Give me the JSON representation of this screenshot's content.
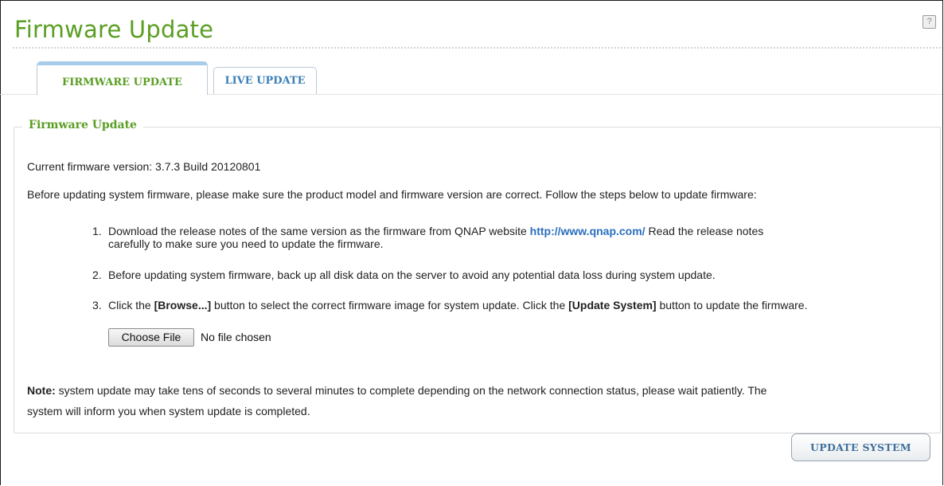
{
  "page": {
    "title": "Firmware Update",
    "help_icon": "?"
  },
  "tabs": [
    {
      "label": "FIRMWARE UPDATE",
      "active": true
    },
    {
      "label": "LIVE UPDATE",
      "active": false
    }
  ],
  "section": {
    "legend": "Firmware Update",
    "current_version": "Current firmware version: 3.7.3 Build 20120801",
    "intro": "Before updating system firmware, please make sure the product model and firmware version are correct. Follow the steps below to update firmware:",
    "steps": [
      {
        "number": "1.",
        "line1_a": "Download the release notes of the same version as the firmware from QNAP website ",
        "link": "http://www.qnap.com/",
        "line1_b": " Read the release notes",
        "line2": "carefully to make sure you need to update the firmware."
      },
      {
        "number": "2.",
        "text": "Before updating system firmware, back up all disk data on the server to avoid any potential data loss during system update."
      },
      {
        "number": "3.",
        "text_a": "Click the ",
        "bold_a": "[Browse...]",
        "text_b": " button to select the correct firmware image for system update. Click the ",
        "bold_b": "[Update System]",
        "text_c": " button to update the firmware."
      }
    ],
    "file_input": {
      "button_label": "Choose File",
      "status": "No file chosen"
    },
    "note": {
      "label": "Note:",
      "line1": " system update may take tens of seconds to several minutes to complete depending on the network connection status, please wait patiently. The",
      "line2": "system will inform you when system update is completed."
    }
  },
  "actions": {
    "update_system_label": "UPDATE SYSTEM"
  },
  "colors": {
    "title_green": "#5a9e22",
    "link_blue": "#2a6fbd",
    "tab_blue": "#3a7fb8"
  }
}
